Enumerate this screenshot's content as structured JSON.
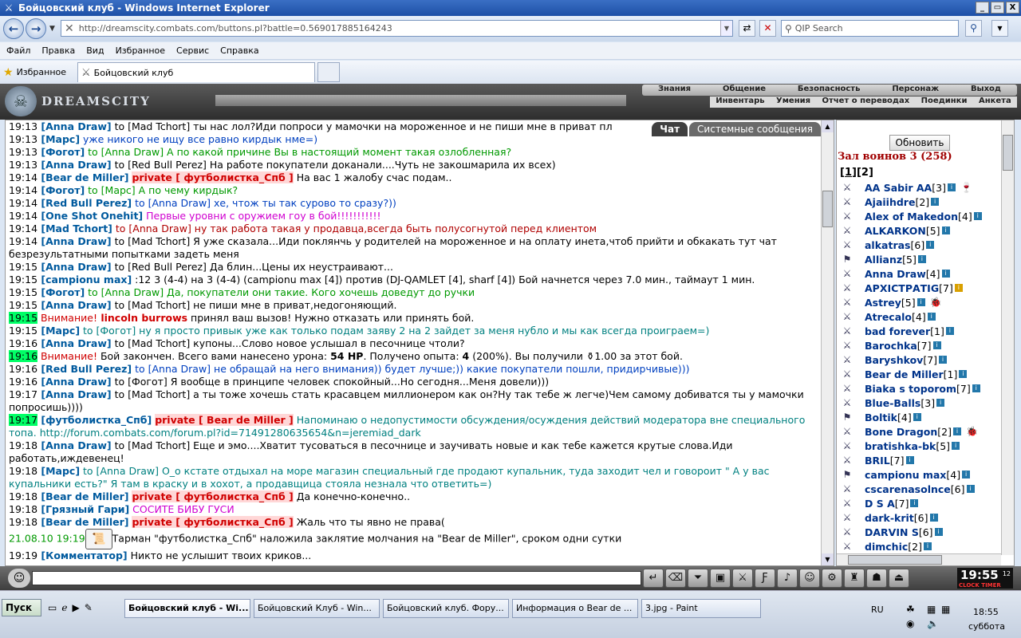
{
  "window": {
    "title": "Бойцовский клуб - Windows Internet Explorer",
    "controls": [
      "_",
      "▭",
      "X"
    ]
  },
  "nav": {
    "url": "http://dreamscity.combats.com/buttons.pl?battle=0.569017885164243",
    "search_placeholder": "QIP Search"
  },
  "menu": [
    "Файл",
    "Правка",
    "Вид",
    "Избранное",
    "Сервис",
    "Справка"
  ],
  "favbar": {
    "favorites": "Избранное",
    "tab_title": "Бойцовский клуб"
  },
  "game": {
    "logo": "DREAMSCITY",
    "top_menu": [
      "Знания",
      "Общение",
      "Безопасность",
      "Персонаж",
      "Выход"
    ],
    "sub_menu": [
      "Инвентарь",
      "Умения",
      "Отчет о переводах",
      "Поединки",
      "Анкета"
    ]
  },
  "chat": {
    "tabs": [
      "Чат",
      "Системные сообщения"
    ],
    "lines": [
      [
        {
          "t": "19:13",
          "c": "tm"
        },
        {
          "t": " [Anna Draw]",
          "c": "nk"
        },
        {
          "t": " to [Mad Tchort] ты нас лол?Иди попроси у мамочки на мороженное и не пиши мне в приват пл",
          "c": "dark"
        }
      ],
      [
        {
          "t": "19:13",
          "c": "tm"
        },
        {
          "t": " [Марс]",
          "c": "nk"
        },
        {
          "t": " уже никого не ищу все равно кирдык нме=)",
          "c": "blue"
        }
      ],
      [
        {
          "t": "19:13",
          "c": "tm"
        },
        {
          "t": " [Фогот]",
          "c": "nk"
        },
        {
          "t": " to [Anna Draw] А по какой причине Вы в настоящий момент такая озлобленная?",
          "c": "green"
        }
      ],
      [
        {
          "t": "19:13",
          "c": "tm"
        },
        {
          "t": " [Anna Draw]",
          "c": "nk"
        },
        {
          "t": " to [Red Bull Perez] На работе покупатели доканали....Чуть не закошмарила их всех)",
          "c": "dark"
        }
      ],
      [
        {
          "t": "19:14",
          "c": "tm"
        },
        {
          "t": " [Bear de Miller]",
          "c": "nk"
        },
        {
          "t": " ",
          "c": "dark"
        },
        {
          "t": "private [ футболистка_Спб ]",
          "c": "priv"
        },
        {
          "t": " На вас 1 жалобу счас подам..",
          "c": "dark"
        }
      ],
      [
        {
          "t": "19:14",
          "c": "tm"
        },
        {
          "t": " [Фогот]",
          "c": "nk"
        },
        {
          "t": " to [Марс] А по чему кирдык?",
          "c": "green"
        }
      ],
      [
        {
          "t": "19:14",
          "c": "tm"
        },
        {
          "t": " [Red Bull Perez]",
          "c": "nk"
        },
        {
          "t": " to [Anna Draw] хе, чтож ты так сурово то сразу?))",
          "c": "blue"
        }
      ],
      [
        {
          "t": "19:14",
          "c": "tm"
        },
        {
          "t": " [One Shot Onehit]",
          "c": "nk"
        },
        {
          "t": " Первые уровни с оружием гоу в бой!!!!!!!!!!!",
          "c": "magenta"
        }
      ],
      [
        {
          "t": "19:14",
          "c": "tm"
        },
        {
          "t": " [Mad Tchort]",
          "c": "nk"
        },
        {
          "t": " to [Anna Draw] ну так работа такая у продавца,всегда быть полусогнутой перед клиентом",
          "c": "red"
        }
      ],
      [
        {
          "t": "19:14",
          "c": "tm"
        },
        {
          "t": " [Anna Draw]",
          "c": "nk"
        },
        {
          "t": " to [Mad Tchort] Я уже сказала...Иди поклянчь у родителей на мороженное и на оплату инета,чтоб прийти и обкакать тут чат безрезультатными попытками задеть меня",
          "c": "dark"
        }
      ],
      [
        {
          "t": "19:15",
          "c": "tm"
        },
        {
          "t": " [Anna Draw]",
          "c": "nk"
        },
        {
          "t": " to [Red Bull Perez] Да блин...Цены их неустраивают...",
          "c": "dark"
        }
      ],
      [
        {
          "t": "19:15",
          "c": "tm"
        },
        {
          "t": " [campionu max]",
          "c": "nk"
        },
        {
          "t": " :12 3 (4-4) на 3 (4-4) (campionu max [4]) против (DJ-QAMLET [4], sharf [4]) Бой начнется через 7.0 мин., таймаут 1 мин.",
          "c": "dark"
        }
      ],
      [
        {
          "t": "19:15",
          "c": "tm"
        },
        {
          "t": " [Фогот]",
          "c": "nk"
        },
        {
          "t": " to [Anna Draw] Да, покупатели они такие. Кого хочешь доведут до ручки",
          "c": "green"
        }
      ],
      [
        {
          "t": "19:15",
          "c": "tm"
        },
        {
          "t": " [Anna Draw]",
          "c": "nk"
        },
        {
          "t": " to [Mad Tchort] не пиши мне в приват,недогоняющий.",
          "c": "dark"
        }
      ],
      [
        {
          "t": "19:15",
          "c": "tm hl"
        },
        {
          "t": " Внимание!",
          "c": "alert"
        },
        {
          "t": " lincoln burrows",
          "c": "alertn"
        },
        {
          "t": " принял ваш вызов! Нужно отказать или принять бой.",
          "c": "dark"
        }
      ],
      [
        {
          "t": "19:15",
          "c": "tm"
        },
        {
          "t": " [Марс]",
          "c": "nk"
        },
        {
          "t": " to [Фогот] ну я просто привык уже как только подам заяву 2 на 2 зайдет за меня нубло и мы как всегда проиграем=)",
          "c": "teal"
        }
      ],
      [
        {
          "t": "19:16",
          "c": "tm"
        },
        {
          "t": " [Anna Draw]",
          "c": "nk"
        },
        {
          "t": " to [Mad Tchort] купоны...Слово новое услышал в песочнице чтоли?",
          "c": "dark"
        }
      ],
      [
        {
          "t": "19:16",
          "c": "tm hl"
        },
        {
          "t": " Внимание!",
          "c": "alert"
        },
        {
          "t": " Бой закончен. Всего вами нанесено урона: ",
          "c": "dark"
        },
        {
          "t": "54 HP",
          "c": "dark b"
        },
        {
          "t": ". Получено опыта: ",
          "c": "dark"
        },
        {
          "t": "4",
          "c": "dark b"
        },
        {
          "t": " (200%). Вы получили ⚱1.00 за этот бой.",
          "c": "dark"
        }
      ],
      [
        {
          "t": "19:16",
          "c": "tm"
        },
        {
          "t": " [Red Bull Perez]",
          "c": "nk"
        },
        {
          "t": " to [Anna Draw] не обращай на него внимания)) будет лучше;)) какие покупатели пошли, придирчивые)))",
          "c": "blue"
        }
      ],
      [
        {
          "t": "19:16",
          "c": "tm"
        },
        {
          "t": " [Anna Draw]",
          "c": "nk"
        },
        {
          "t": " to [Фогот] Я вообще в принципе человек спокойный...Но сегодня...Меня довели)))",
          "c": "dark"
        }
      ],
      [
        {
          "t": "19:17",
          "c": "tm"
        },
        {
          "t": " [Anna Draw]",
          "c": "nk"
        },
        {
          "t": " to [Mad Tchort] а ты тоже хочешь стать красавцем миллионером как он?Ну так тебе ж легче)Чем самому добиватся ты у мамочки попросишь))))",
          "c": "dark"
        }
      ],
      [
        {
          "t": "19:17",
          "c": "tm hl"
        },
        {
          "t": " [футболистка_Спб]",
          "c": "nk"
        },
        {
          "t": " ",
          "c": "dark"
        },
        {
          "t": "private [ Bear de Miller ]",
          "c": "priv"
        },
        {
          "t": " Напоминаю о недопустимости обсуждения/осуждения действий модератора вне специального топа. http://forum.combats.com/forum.pl?id=71491280635654&n=jeremiad_dark",
          "c": "teal"
        }
      ],
      [
        {
          "t": "19:18",
          "c": "tm"
        },
        {
          "t": " [Anna Draw]",
          "c": "nk"
        },
        {
          "t": " to [Mad Tchort] Еще и эмо....Хватит тусоваться в песочнице и заучивать новые и как тебе кажется крутые слова.Иди работать,иждевенец!",
          "c": "dark"
        }
      ],
      [
        {
          "t": "19:18",
          "c": "tm"
        },
        {
          "t": " [Марс]",
          "c": "nk"
        },
        {
          "t": " to [Anna Draw] О_о кстате отдыхал на море магазин специальный где продают купальник, туда заходит чел и говороит \" А у вас купальники есть?\" Я там в краску и в хохот, а продавщица стояла незнала что ответить=)",
          "c": "teal"
        }
      ],
      [
        {
          "t": "19:18",
          "c": "tm"
        },
        {
          "t": " [Bear de Miller]",
          "c": "nk"
        },
        {
          "t": " ",
          "c": "dark"
        },
        {
          "t": "private [ футболистка_Спб ]",
          "c": "priv"
        },
        {
          "t": " Да конечно-конечно..",
          "c": "dark"
        }
      ],
      [
        {
          "t": "19:18",
          "c": "tm"
        },
        {
          "t": " [Грязный Гари]",
          "c": "nk"
        },
        {
          "t": " СОСИТЕ БИБУ ГУСИ",
          "c": "magenta"
        }
      ],
      [
        {
          "t": "19:18",
          "c": "tm"
        },
        {
          "t": " [Bear de Miller]",
          "c": "nk"
        },
        {
          "t": " ",
          "c": "dark"
        },
        {
          "t": "private [ футболистка_Спб ]",
          "c": "priv"
        },
        {
          "t": " Жаль что ты явно не права(",
          "c": "dark"
        }
      ],
      [
        {
          "t": "21.08.10 19:19",
          "c": "green"
        },
        {
          "t": " 📜 ",
          "c": "spell"
        },
        {
          "t": "Тарман \"футболистка_Спб\" наложила заклятие молчания на \"Bear de Miller\", сроком одни сутки",
          "c": "dark"
        }
      ],
      [
        {
          "t": "19:19",
          "c": "tm"
        },
        {
          "t": " [Комментатор]",
          "c": "nk"
        },
        {
          "t": " Никто не услышит твоих криков...",
          "c": "dark"
        }
      ]
    ]
  },
  "room": {
    "refresh": "Обновить",
    "title": "Зал воинов 3 (258)",
    "pages": [
      "1",
      "2"
    ],
    "users": [
      {
        "name": "AA Sabir AA",
        "level": "[3]",
        "extra": "🍷"
      },
      {
        "name": "Ajaiihdre",
        "level": "[2]"
      },
      {
        "name": "Alex of Makedon",
        "level": "[4]"
      },
      {
        "name": "ALKARKON",
        "level": "[5]"
      },
      {
        "name": "alkatras",
        "level": "[6]"
      },
      {
        "name": "Allianz",
        "level": "[5]"
      },
      {
        "name": "Anna Draw",
        "level": "[4]"
      },
      {
        "name": "АРХІСТРАТІG",
        "level": "[7]",
        "yellow": true
      },
      {
        "name": "Astrey",
        "level": "[5]",
        "extra": "🐞"
      },
      {
        "name": "Atrecalo",
        "level": "[4]"
      },
      {
        "name": "bad forever",
        "level": "[1]"
      },
      {
        "name": "Barochka",
        "level": "[7]"
      },
      {
        "name": "Baryshkov",
        "level": "[7]"
      },
      {
        "name": "Bear de Miller",
        "level": "[1]"
      },
      {
        "name": "Biaka s toporom",
        "level": "[7]"
      },
      {
        "name": "Blue-Balls",
        "level": "[3]"
      },
      {
        "name": "Boltik",
        "level": "[4]"
      },
      {
        "name": "Bone Dragon",
        "level": "[2]",
        "extra": "🐞"
      },
      {
        "name": "bratishka-bk",
        "level": "[5]"
      },
      {
        "name": "BRIL",
        "level": "[7]"
      },
      {
        "name": "campionu max",
        "level": "[4]"
      },
      {
        "name": "cscarenasolnce",
        "level": "[6]"
      },
      {
        "name": "D S A",
        "level": "[7]"
      },
      {
        "name": "dark-krit",
        "level": "[6]"
      },
      {
        "name": "DARVIN S",
        "level": "[6]"
      },
      {
        "name": "dimchic",
        "level": "[2]"
      }
    ]
  },
  "clock": {
    "time": "19:55",
    "secs": "12",
    "label": "CLOCK TIMER"
  },
  "taskbar": {
    "start": "Пуск",
    "tasks": [
      "Бойцовский клуб - Wi...",
      "Бойцовский Клуб - Win...",
      "Бойцовский клуб. Фору...",
      "Информация о Bear de ...",
      "3.jpg - Paint"
    ],
    "lang": "RU",
    "time": "18:55",
    "day": "суббота"
  },
  "colors": {
    "highlight": "#00ff66",
    "nick": "#005a9e",
    "private": "#d00000"
  }
}
